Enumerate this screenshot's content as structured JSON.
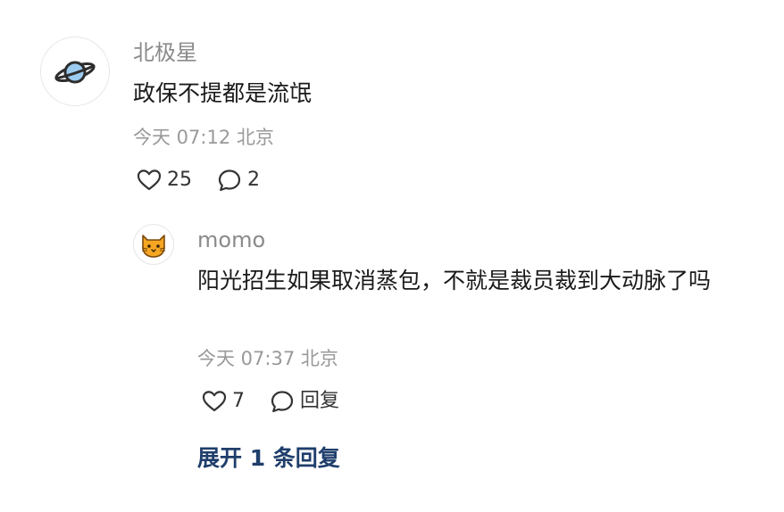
{
  "comment": {
    "username": "北极星",
    "text": "政保不提都是流氓",
    "time": "今天 07:12",
    "location": "北京",
    "likes": "25",
    "replies": "2",
    "avatar_icon": "planet-icon"
  },
  "reply": {
    "username": "momo",
    "text": "阳光招生如果取消蒸包，不就是裁员裁到大动脉了吗",
    "time": "今天 07:37",
    "location": "北京",
    "likes": "7",
    "reply_label": "回复",
    "avatar_icon": "cat-icon"
  },
  "expand_label": "展开 1 条回复",
  "colors": {
    "link": "#1f3e6b",
    "meta": "#999999",
    "name": "#8a8a8a",
    "planet": "#9ccbf0",
    "cat": "#f5a623"
  }
}
